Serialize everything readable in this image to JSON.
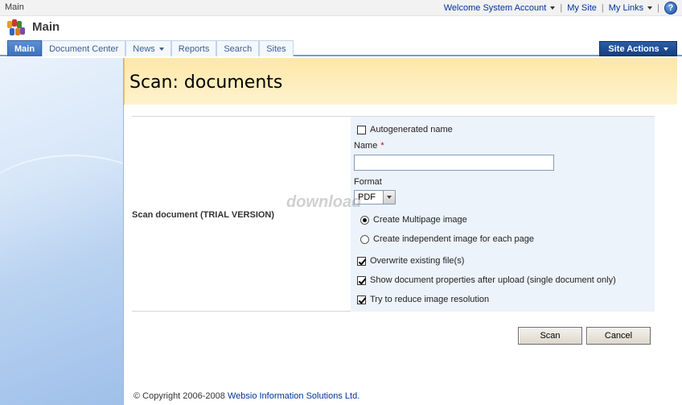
{
  "topbar": {
    "breadcrumb": "Main",
    "welcome": "Welcome System Account",
    "my_site": "My Site",
    "my_links": "My Links",
    "help_glyph": "?"
  },
  "site": {
    "title": "Main"
  },
  "nav": {
    "tabs": [
      {
        "label": "Main",
        "active": true
      },
      {
        "label": "Document Center"
      },
      {
        "label": "News",
        "has_menu": true
      },
      {
        "label": "Reports"
      },
      {
        "label": "Search"
      },
      {
        "label": "Sites"
      }
    ],
    "site_actions": "Site Actions"
  },
  "page": {
    "title": "Scan: documents"
  },
  "form": {
    "section_label": "Scan document (TRIAL VERSION)",
    "autogenerated_name": "Autogenerated name",
    "name_label": "Name",
    "required_marker": "*",
    "name_value": "",
    "format_label": "Format",
    "format_value": "PDF",
    "radio_multipage": "Create Multipage image",
    "radio_independent": "Create independent image for each page",
    "overwrite": "Overwrite existing file(s)",
    "show_properties": "Show document properties after upload (single document only)",
    "reduce_resolution": "Try to reduce image resolution",
    "checked": {
      "autogenerated": false,
      "overwrite": true,
      "show_properties": true,
      "reduce_resolution": true
    },
    "selected_radio": "multipage"
  },
  "buttons": {
    "scan": "Scan",
    "cancel": "Cancel"
  },
  "watermark": "download",
  "footer": {
    "copyright": "© Copyright 2006-2008",
    "company": "Websio Information Solutions Ltd."
  },
  "colors": {
    "accent": "#3a6fbd",
    "header_bg": "#fde7a8",
    "link": "#003399"
  }
}
